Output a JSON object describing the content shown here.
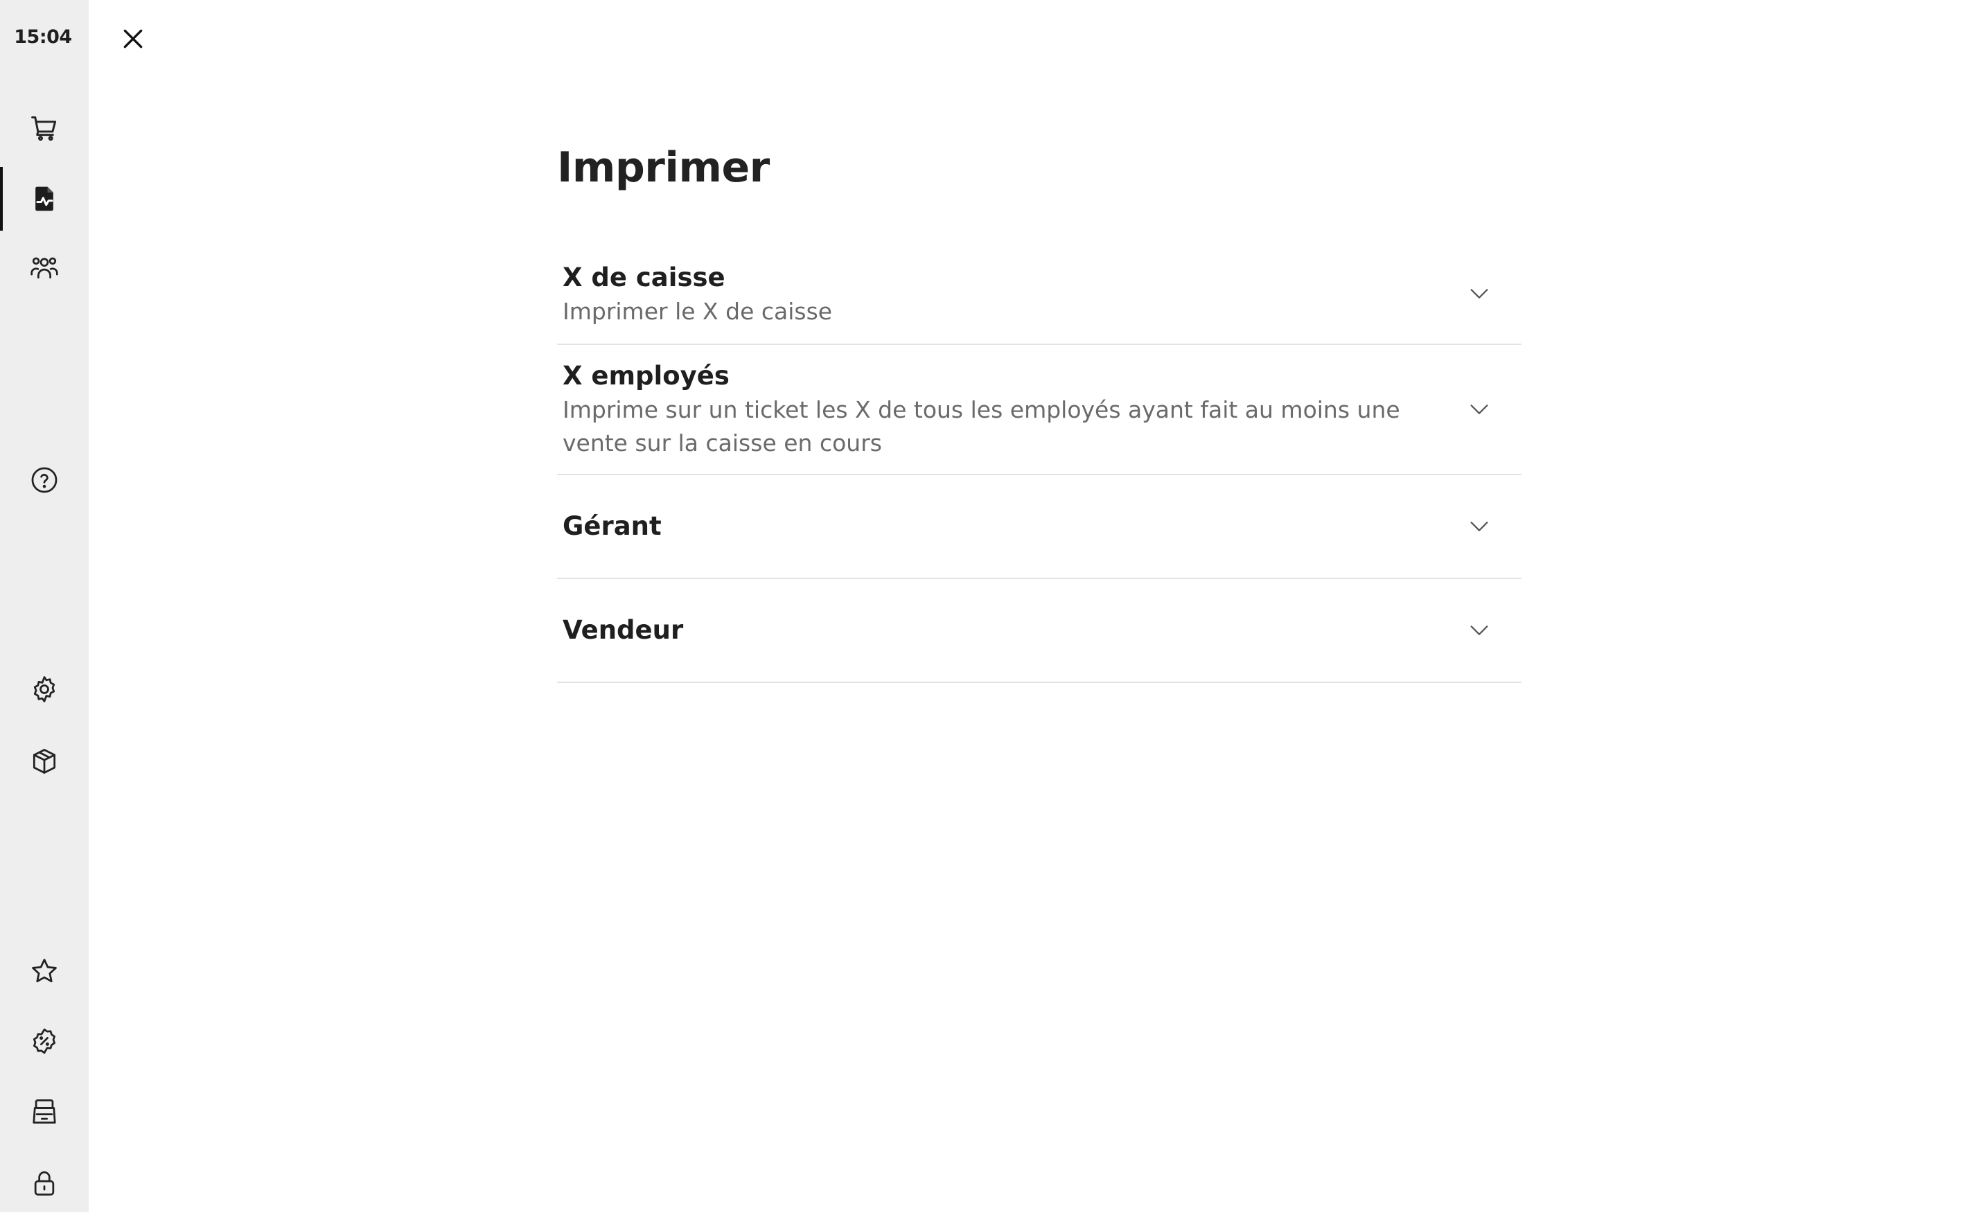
{
  "status": {
    "time": "15:04"
  },
  "sidebar": {
    "items": [
      {
        "name": "cart",
        "icon": "cart-icon",
        "active": false
      },
      {
        "name": "reports",
        "icon": "document-chart-icon",
        "active": true
      },
      {
        "name": "customers",
        "icon": "users-icon",
        "active": false
      },
      {
        "name": "help",
        "icon": "help-circle-icon",
        "active": false
      },
      {
        "name": "settings",
        "icon": "gear-icon",
        "active": false
      },
      {
        "name": "products",
        "icon": "box-icon",
        "active": false
      },
      {
        "name": "favorites",
        "icon": "star-icon",
        "active": false
      },
      {
        "name": "discounts",
        "icon": "discount-badge-icon",
        "active": false
      },
      {
        "name": "register",
        "icon": "cash-register-icon",
        "active": false
      },
      {
        "name": "lock",
        "icon": "lock-icon",
        "active": false
      }
    ]
  },
  "header": {
    "close_icon": "close-icon"
  },
  "main": {
    "title": "Imprimer",
    "sections": [
      {
        "title": "X de caisse",
        "description": "Imprimer le X de caisse",
        "expanded": false
      },
      {
        "title": "X employés",
        "description": "Imprime sur un ticket les X de tous les employés ayant fait au moins une vente sur la caisse en cours",
        "expanded": false
      },
      {
        "title": "Gérant",
        "description": "",
        "expanded": false
      },
      {
        "title": "Vendeur",
        "description": "",
        "expanded": false
      }
    ]
  },
  "colors": {
    "sidebar_bg": "#eeeeee",
    "text_primary": "#1f1f1f",
    "text_secondary": "#6a6a6a",
    "divider": "#e3e3e3",
    "active_indicator": "#111111"
  }
}
